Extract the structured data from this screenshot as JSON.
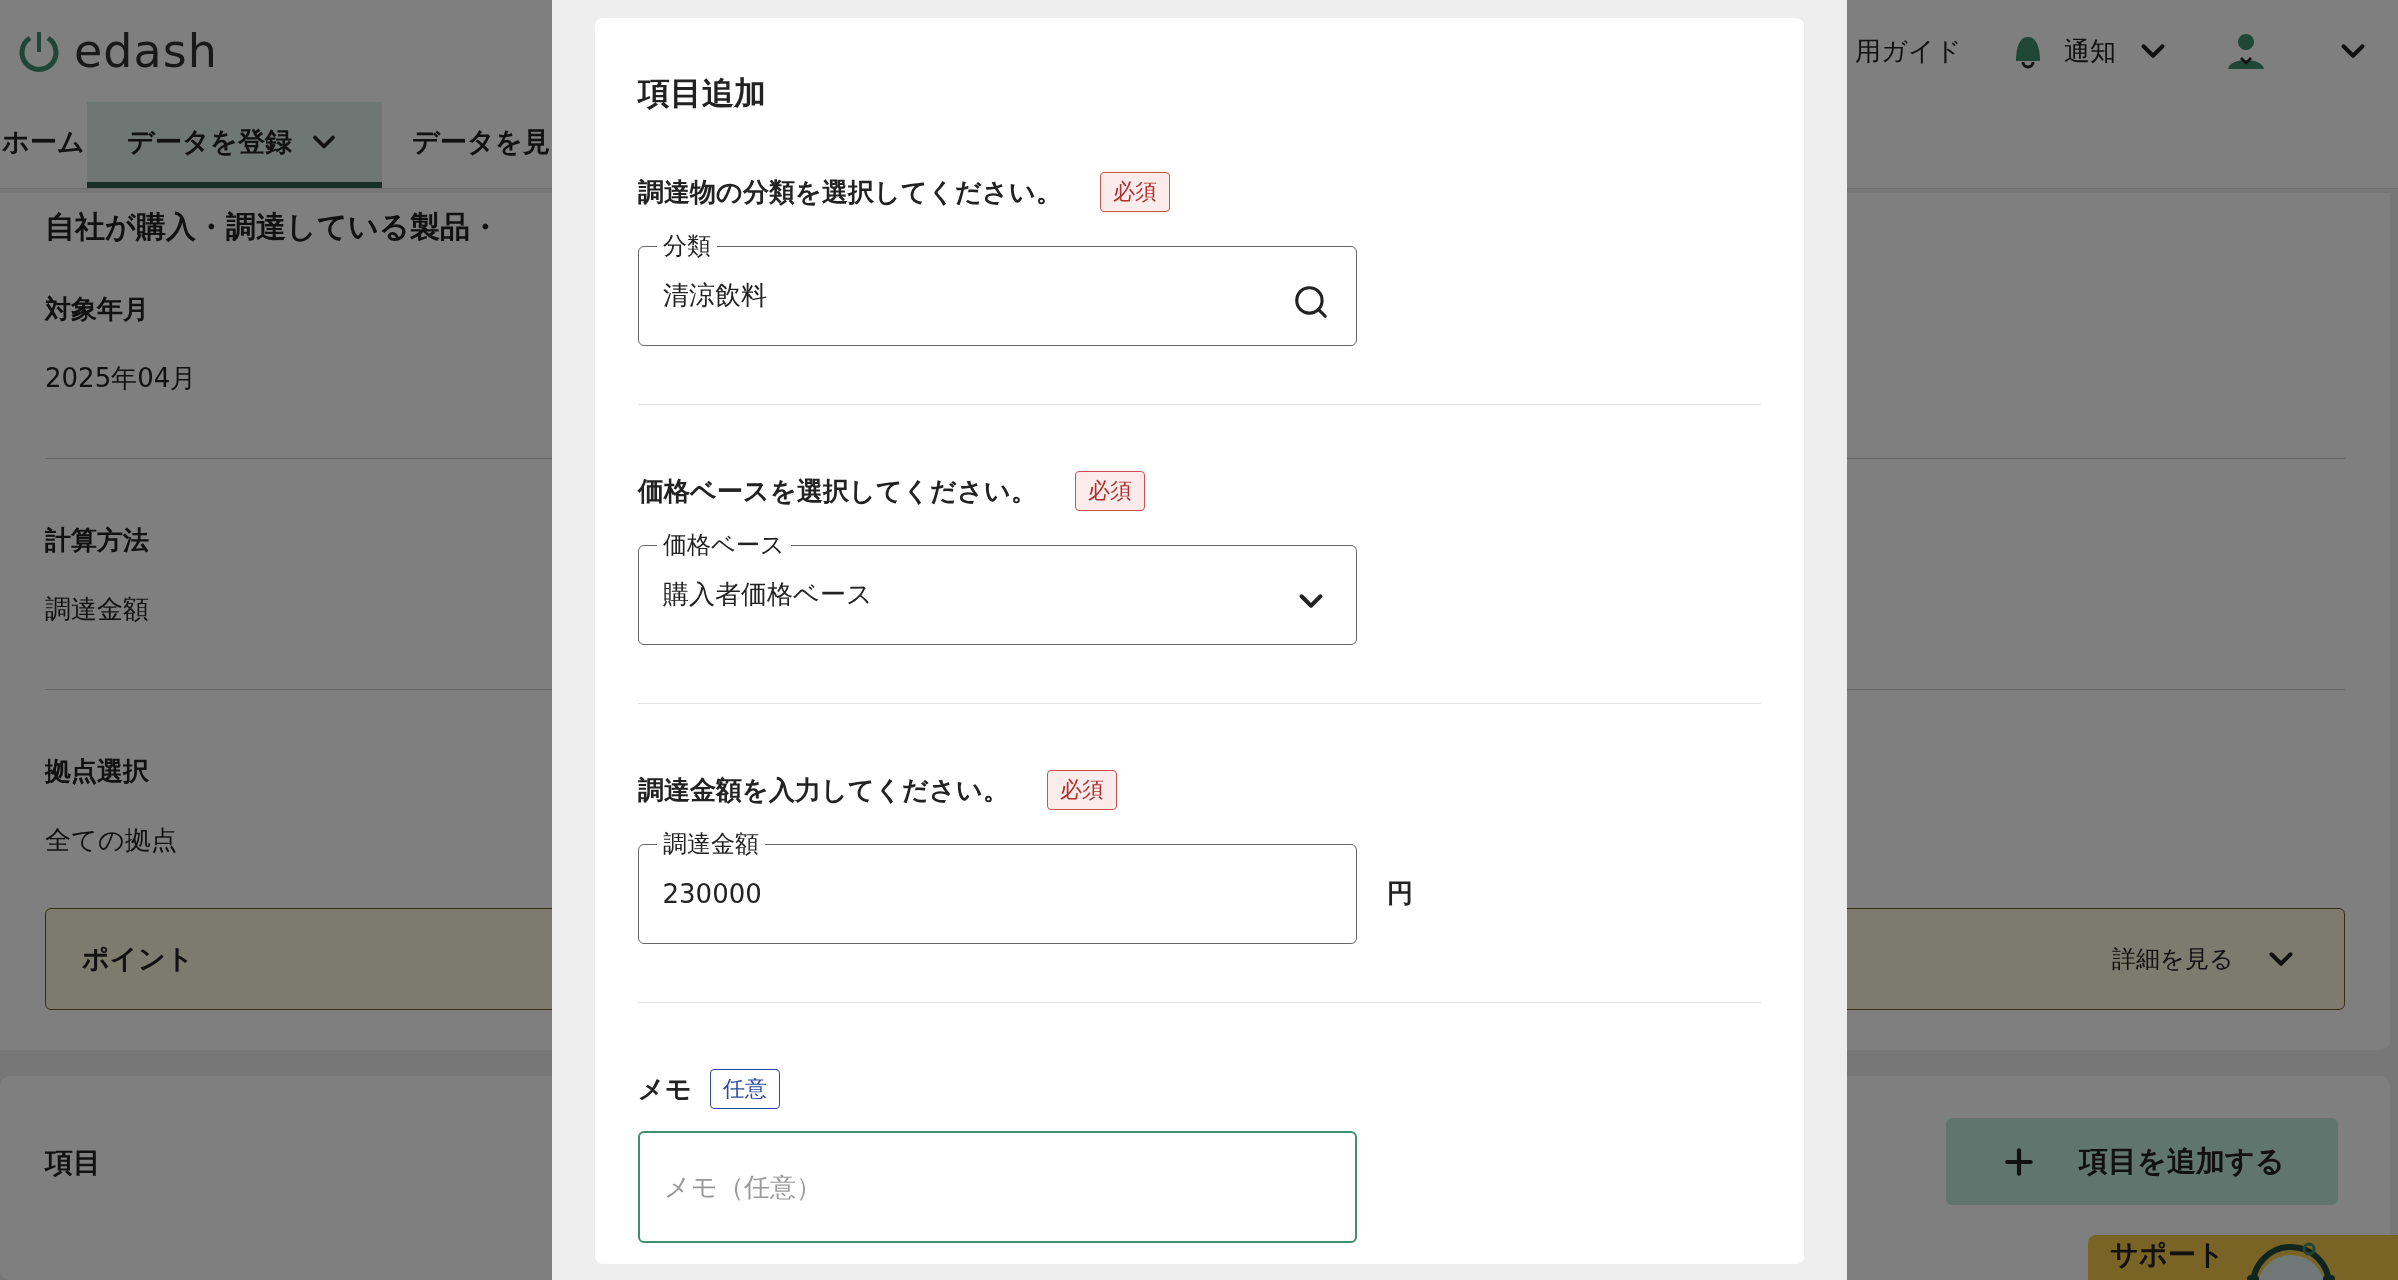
{
  "header": {
    "logo": "edash",
    "guide": "用ガイド",
    "notice": "通知"
  },
  "nav": [
    {
      "label": "ホーム",
      "selected": false,
      "dropdown": false
    },
    {
      "label": "データを登録",
      "selected": true,
      "dropdown": true
    },
    {
      "label": "データを見",
      "selected": false,
      "dropdown": false
    }
  ],
  "summary": {
    "title": "自社が購入・調達している製品・",
    "fields": [
      {
        "label": "対象年月",
        "value": "2025年04月"
      },
      {
        "label": "計算方法",
        "value": "調達金額"
      },
      {
        "label": "拠点選択",
        "value": "全ての拠点"
      }
    ],
    "point": {
      "label": "ポイント",
      "link": "詳細を見る"
    }
  },
  "items": {
    "title": "項目",
    "add_button": "項目を追加する"
  },
  "support": {
    "label": "サポート"
  },
  "modal": {
    "title": "項目追加",
    "sections": [
      {
        "prompt": "調達物の分類を選択してください。",
        "badge": {
          "text": "必須",
          "kind": "required"
        },
        "field": {
          "kind": "search",
          "label": "分類",
          "value": "清涼飲料",
          "focused": false
        }
      },
      {
        "prompt": "価格ベースを選択してください。",
        "badge": {
          "text": "必須",
          "kind": "required"
        },
        "field": {
          "kind": "select",
          "label": "価格ベース",
          "value": "購入者価格ベース",
          "focused": false
        }
      },
      {
        "prompt": "調達金額を入力してください。",
        "badge": {
          "text": "必須",
          "kind": "required"
        },
        "field": {
          "kind": "text",
          "label": "調達金額",
          "value": "230000",
          "unit": "円",
          "focused": false
        }
      },
      {
        "prompt": "メモ",
        "badge": {
          "text": "任意",
          "kind": "optional"
        },
        "field": {
          "kind": "text",
          "placeholder": "メモ（任意）",
          "focused": true
        }
      }
    ]
  }
}
